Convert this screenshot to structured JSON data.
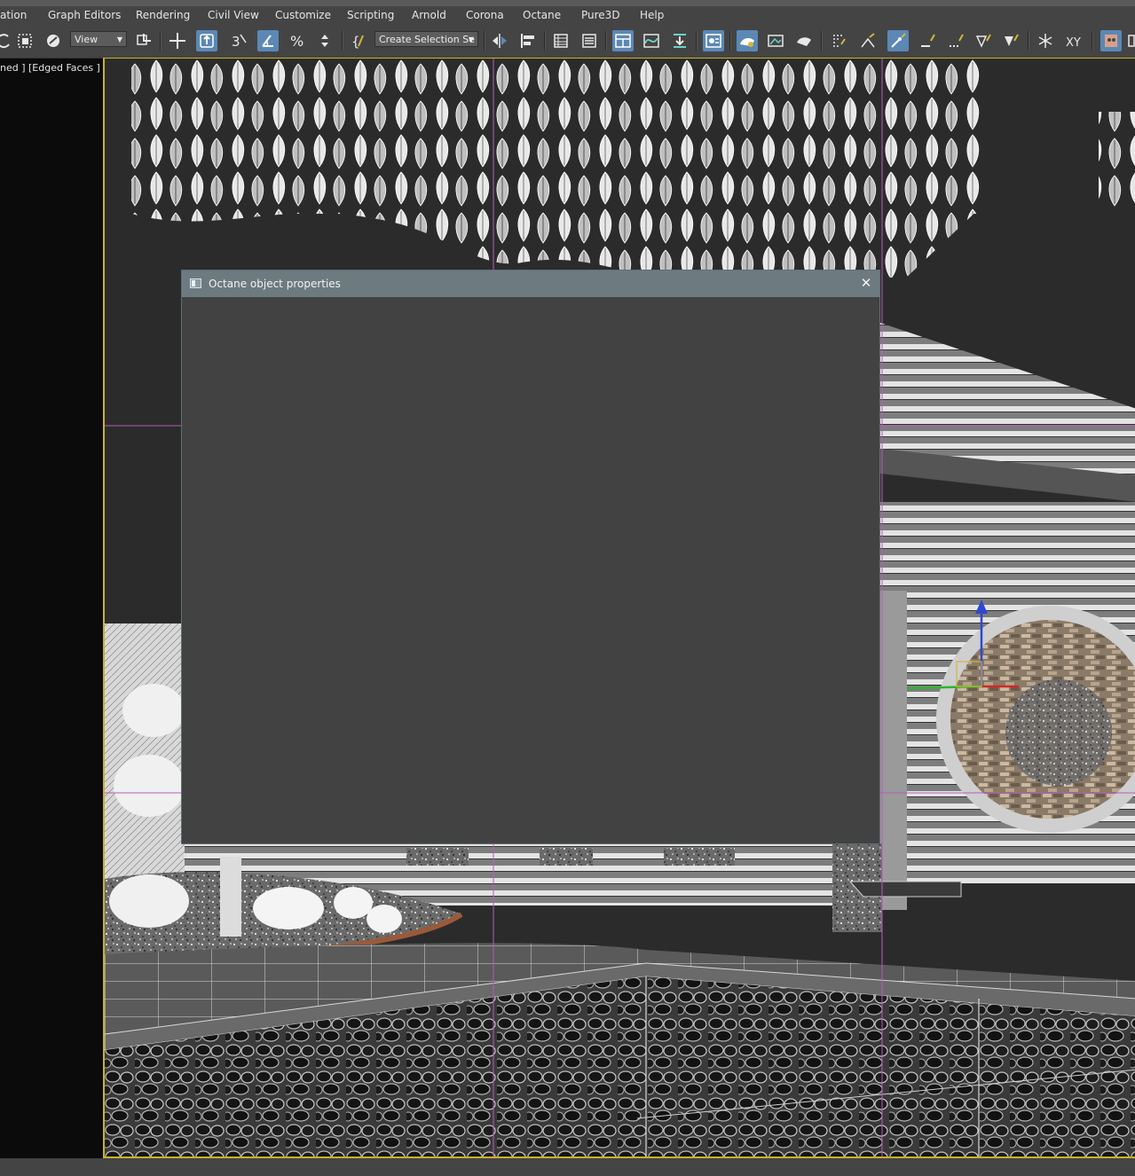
{
  "menubar": {
    "items": [
      "ation",
      "Graph Editors",
      "Rendering",
      "Civil View",
      "Customize",
      "Scripting",
      "Arnold",
      "Corona",
      "Octane",
      "Pure3D",
      "Help"
    ]
  },
  "toolbar": {
    "view_dropdown": "View",
    "selection_set_dropdown": "Create Selection Se",
    "icons": [
      "redo-icon",
      "region-select-icon",
      "link-icon",
      "move-icon",
      "select-manipulate-icon",
      "snap-3d-icon",
      "angle-snap-icon",
      "percent-snap-icon",
      "spinner-snap-icon",
      "named-selection-icon",
      "mirror-icon",
      "align-icon",
      "scene-explorer-icon",
      "layer-explorer-icon",
      "toggle-ribbon-icon",
      "curve-editor-icon",
      "schematic-view-icon",
      "material-editor-icon",
      "render-setup-icon",
      "render-frame-icon",
      "render-icon"
    ]
  },
  "viewport": {
    "label": "ned ] [Edged Faces ]",
    "border_color": "#c9b322"
  },
  "dialog": {
    "title": "Octane object properties",
    "close_glyph": "✕"
  },
  "colors": {
    "ui_bg": "#444444",
    "dialog_title_bg": "#6d7a80",
    "dialog_body_bg": "#424242",
    "active_button": "#5b88b5"
  }
}
